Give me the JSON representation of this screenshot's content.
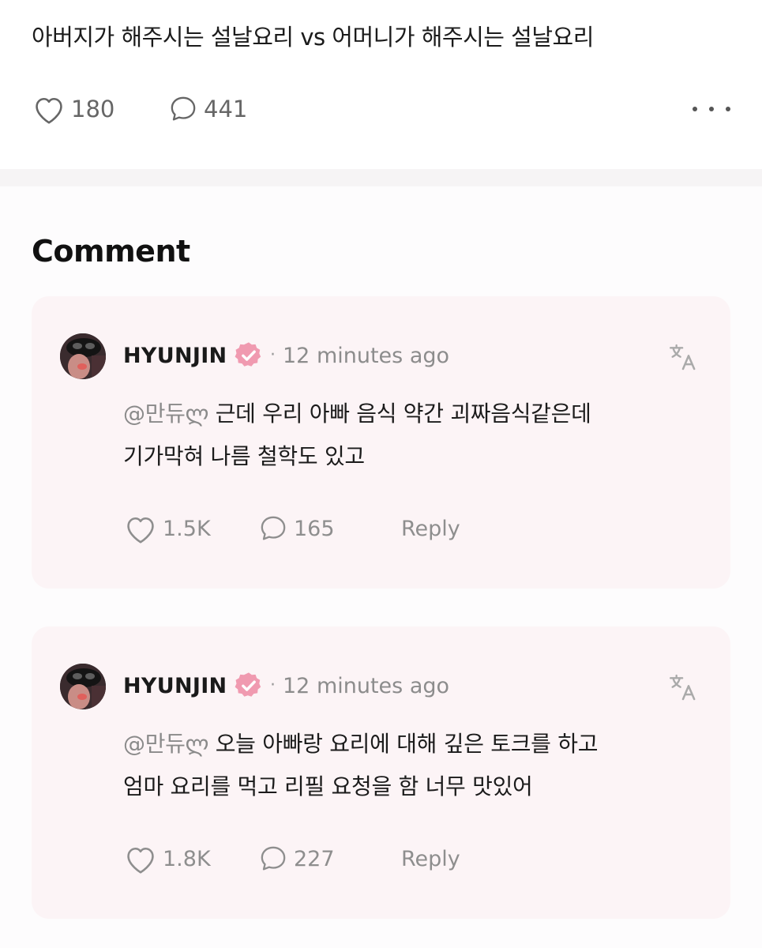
{
  "post": {
    "title": "아버지가 해주시는 설날요리 vs 어머니가 해주시는 설날요리",
    "likes": "180",
    "comments": "441"
  },
  "comments_section": {
    "title": "Comment"
  },
  "comments": [
    {
      "author": "HYUNJIN",
      "separator": "·",
      "time": "12 minutes ago",
      "mention": "@만듀ლ",
      "line1": " 근데 우리 아빠 음식 약간 괴짜음식같은데",
      "line2": "기가막혀 나름 철학도 있고",
      "likes": "1.5K",
      "replies": "165",
      "reply_label": "Reply"
    },
    {
      "author": "HYUNJIN",
      "separator": "·",
      "time": "12 minutes ago",
      "mention": "@만듀ლ",
      "line1": " 오늘 아빠랑 요리에 대해 깊은 토크를 하고",
      "line2": "엄마 요리를 먹고 리필 요청을 함 너무 맛있어",
      "likes": "1.8K",
      "replies": "227",
      "reply_label": "Reply"
    }
  ],
  "icons": {
    "like": "heart-icon",
    "comment": "speech-bubble-icon",
    "more": "more-dots-icon",
    "verified": "verified-badge-icon",
    "translate": "translate-icon"
  },
  "colors": {
    "card_background": "#fcf4f6",
    "verified_badge": "#f09ab0",
    "muted_text": "#8e8e8e"
  }
}
